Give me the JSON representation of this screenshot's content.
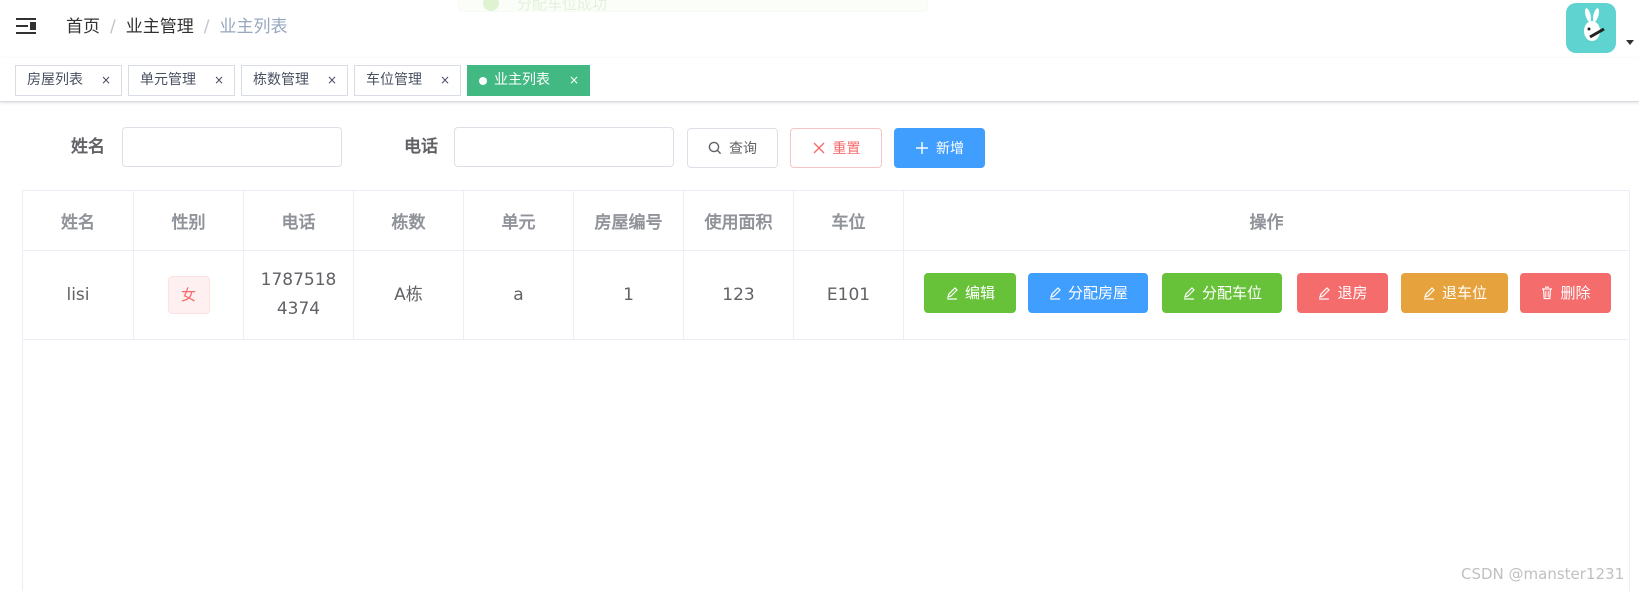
{
  "navbar": {
    "breadcrumb": [
      "首页",
      "业主管理",
      "业主列表"
    ],
    "separator": "/",
    "toast_message": "分配车位成功"
  },
  "tags": [
    {
      "label": "房屋列表",
      "close": "×",
      "active": false
    },
    {
      "label": "单元管理",
      "close": "×",
      "active": false
    },
    {
      "label": "栋数管理",
      "close": "×",
      "active": false
    },
    {
      "label": "车位管理",
      "close": "×",
      "active": false
    },
    {
      "label": "业主列表",
      "close": "×",
      "active": true
    }
  ],
  "search": {
    "name_label": "姓名",
    "name_value": "",
    "phone_label": "电话",
    "phone_value": "",
    "query_label": "查询",
    "reset_label": "重置",
    "add_label": "新增"
  },
  "table": {
    "columns": [
      "姓名",
      "性别",
      "电话",
      "栋数",
      "单元",
      "房屋编号",
      "使用面积",
      "车位",
      "操作"
    ],
    "rows": [
      {
        "name": "lisi",
        "sex": "女",
        "phone": "17875184374",
        "building": "A栋",
        "unit": "a",
        "house_no": "1",
        "area": "123",
        "parking": "E101"
      }
    ],
    "actions": [
      "编辑",
      "分配房屋",
      "分配车位",
      "退房",
      "退车位",
      "删除"
    ]
  },
  "colors": {
    "primary": "#409eff",
    "success": "#67c23a",
    "danger": "#f56c6c",
    "warning": "#e6a23c",
    "tag_active": "#42b983"
  },
  "watermark": "CSDN @manster1231"
}
